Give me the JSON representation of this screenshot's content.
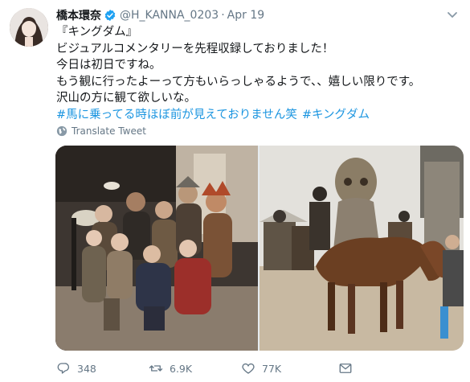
{
  "author": {
    "display_name": "橋本環奈",
    "handle": "@H_KANNA_0203",
    "separator": "·",
    "date": "Apr 19",
    "verified_icon": "verified-badge-icon",
    "avatar_icon": "avatar"
  },
  "tweet": {
    "lines": [
      "『キングダム』",
      "ビジュアルコメンタリーを先程収録しておりました！",
      "今日は初日ですね。",
      "もう観に行ったよーって方もいらっしゃるようで、、嬉しい限りです。",
      "沢山の方に観て欲しいな。"
    ],
    "hashtags": [
      "#馬に乗ってる時ほぼ前が見えておりません笑",
      "#キングダム"
    ]
  },
  "translate_label": "Translate Tweet",
  "actions": {
    "reply_count": "348",
    "retweet_count": "6.9K",
    "like_count": "77K"
  },
  "colors": {
    "link": "#1b95e0",
    "secondary_text": "#657786",
    "verified": "#1da1f2"
  }
}
